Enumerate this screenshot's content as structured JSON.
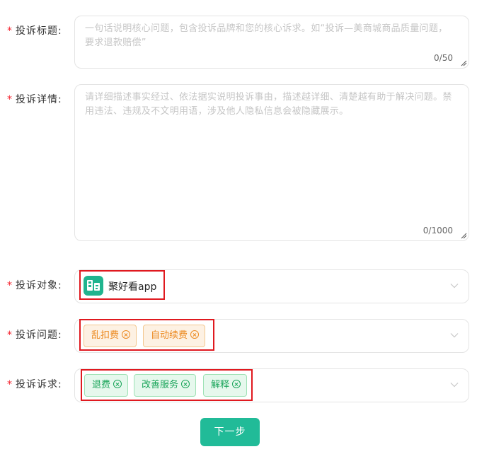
{
  "title_field": {
    "label": "投诉标题:",
    "placeholder": "一句话说明核心问题，包含投诉品牌和您的核心诉求。如“投诉—美商城商品质量问题，要求退款赔偿”",
    "counter": "0/50"
  },
  "detail_field": {
    "label": "投诉详情:",
    "placeholder": "请详细描述事实经过、依法据实说明投诉事由，描述越详细、清楚越有助于解决问题。禁用违法、违规及不文明用语，涉及他人隐私信息会被隐藏展示。",
    "counter": "0/1000"
  },
  "target_field": {
    "label": "投诉对象:",
    "selected_name": "聚好看app",
    "logo_icon": "app-logo-icon"
  },
  "issue_field": {
    "label": "投诉问题:",
    "tags": [
      "乱扣费",
      "自动续费"
    ],
    "tag_color": "#ec8a21"
  },
  "demand_field": {
    "label": "投诉诉求:",
    "tags": [
      "退费",
      "改善服务",
      "解释"
    ],
    "tag_color": "#1aa55a"
  },
  "actions": {
    "next_label": "下一步",
    "accent": "#21bb98"
  },
  "required_marker": "*"
}
